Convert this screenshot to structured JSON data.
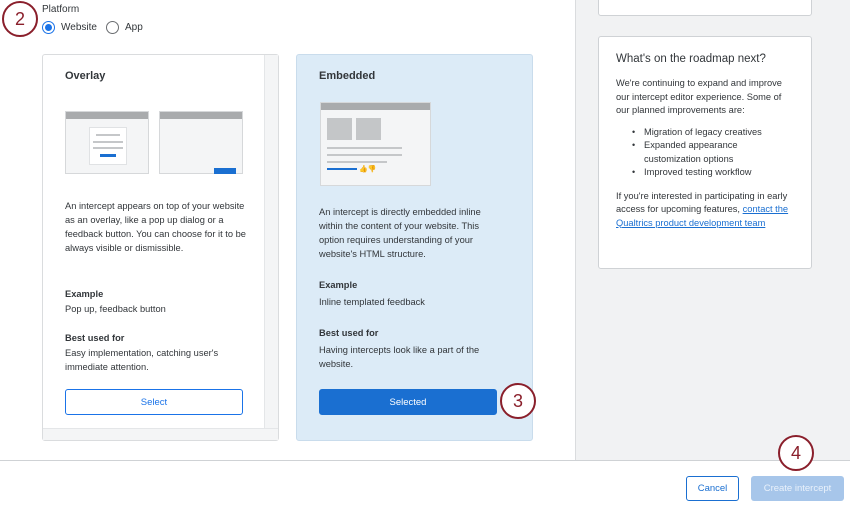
{
  "callouts": {
    "c2": "2",
    "c3": "3",
    "c4": "4"
  },
  "platform": {
    "label": "Platform",
    "options": [
      {
        "label": "Website",
        "selected": true
      },
      {
        "label": "App",
        "selected": false
      }
    ]
  },
  "cards": [
    {
      "title": "Overlay",
      "description": "An intercept appears on top of your website as an overlay, like a pop up dialog or a feedback button. You can choose for it to be always visible or dismissible.",
      "example_label": "Example",
      "example_value": "Pop up, feedback button",
      "best_label": "Best used for",
      "best_value": "Easy implementation, catching user's immediate attention.",
      "button_label": "Select",
      "selected": false
    },
    {
      "title": "Embedded",
      "description": "An intercept is directly embedded inline within the content of your website. This option requires understanding of your website's HTML structure.",
      "example_label": "Example",
      "example_value": "Inline templated feedback",
      "best_label": "Best used for",
      "best_value": "Having intercepts look like a part of the website.",
      "button_label": "Selected",
      "selected": true
    }
  ],
  "roadmap": {
    "title": "What's on the roadmap next?",
    "intro": "We're continuing to expand and improve our intercept editor experience. Some of our planned improvements are:",
    "items": [
      "Migration of legacy creatives",
      "Expanded appearance customization options",
      "Improved testing workflow"
    ],
    "outro": "If you're interested in participating in early access for upcoming features,",
    "link": "contact the Qualtrics product development team"
  },
  "footer": {
    "cancel": "Cancel",
    "create": "Create intercept"
  },
  "colors": {
    "accent": "#1a6fd1",
    "callout": "#8a1f2b",
    "selected_card": "#dcebf7",
    "disabled_button": "#a7c6ea"
  }
}
